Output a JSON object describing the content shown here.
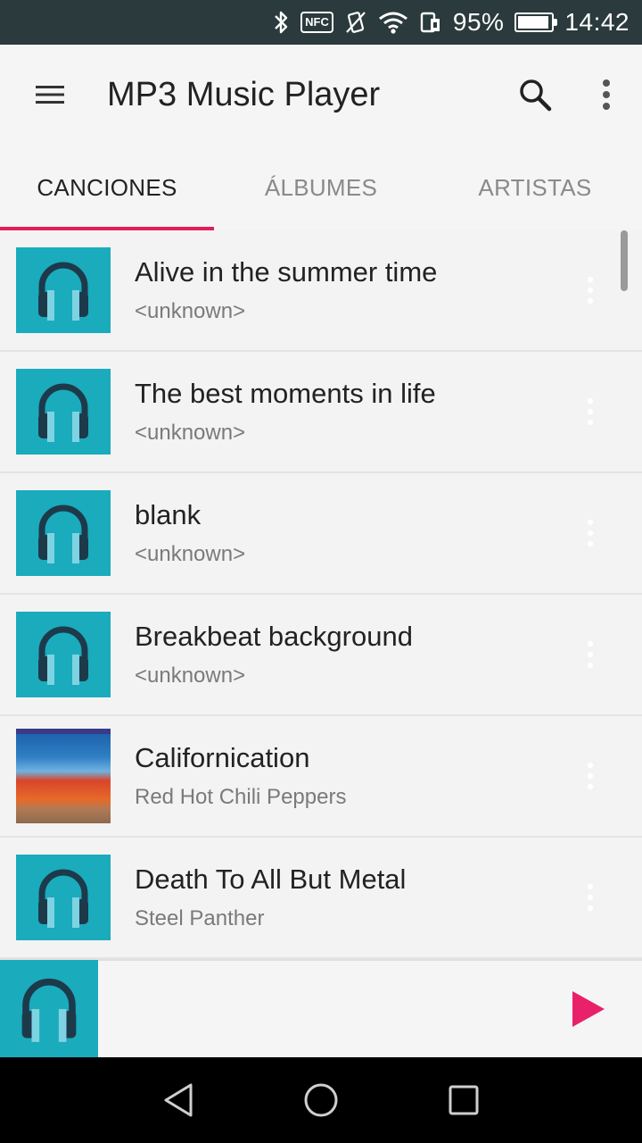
{
  "status_bar": {
    "battery_percent_text": "95%",
    "battery_level": 0.95,
    "time": "14:42",
    "nfc_label": "NFC"
  },
  "app_bar": {
    "title": "MP3 Music Player"
  },
  "tabs": [
    {
      "label": "CANCIONES",
      "active": true
    },
    {
      "label": "ÁLBUMES",
      "active": false
    },
    {
      "label": "ARTISTAS",
      "active": false
    }
  ],
  "songs": [
    {
      "title": "Alive in the summer time",
      "artist": "<unknown>",
      "art": "headphones-icon"
    },
    {
      "title": "The best moments in life",
      "artist": "<unknown>",
      "art": "headphones-icon"
    },
    {
      "title": "blank",
      "artist": "<unknown>",
      "art": "headphones-icon"
    },
    {
      "title": "Breakbeat background",
      "artist": "<unknown>",
      "art": "headphones-icon"
    },
    {
      "title": "Californication",
      "artist": "Red Hot Chili Peppers",
      "art": "album-art"
    },
    {
      "title": "Death To All But Metal",
      "artist": "Steel Panther",
      "art": "headphones-icon"
    }
  ],
  "colors": {
    "accent": "#e01e5a",
    "thumb_bg": "#1aabbd",
    "status_bar": "#2b3a3c"
  }
}
